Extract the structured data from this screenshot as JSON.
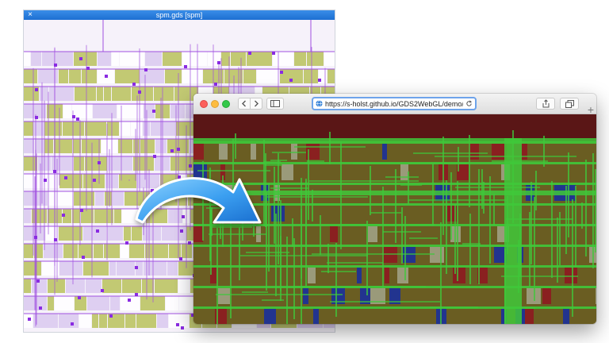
{
  "gds_window": {
    "title": "spm.gds [spm]",
    "close_glyph": "×"
  },
  "browser": {
    "url": "https://s-holst.github.io/GDS2WebGL/demo/",
    "icons": {
      "back": "chevron-left-icon",
      "forward": "chevron-right-icon",
      "sidebar": "sidebar-icon",
      "reload": "reload-icon",
      "share": "share-icon",
      "tabs": "tabs-icon",
      "new_tab": "+"
    },
    "traffic_colors": {
      "close": "#fc605c",
      "minimize": "#fdbc40",
      "zoom": "#34c84a"
    }
  },
  "arrow": {
    "icon": "curved-arrow-icon",
    "color": "#3b9ff0"
  },
  "colors": {
    "layout_green": "#3fc83a",
    "layout_olive": "#6a5d22",
    "layout_red": "#8a2020",
    "layout_blue": "#22348f",
    "gds_purple": "#a050e0",
    "gds_olive": "#b8c25a"
  }
}
